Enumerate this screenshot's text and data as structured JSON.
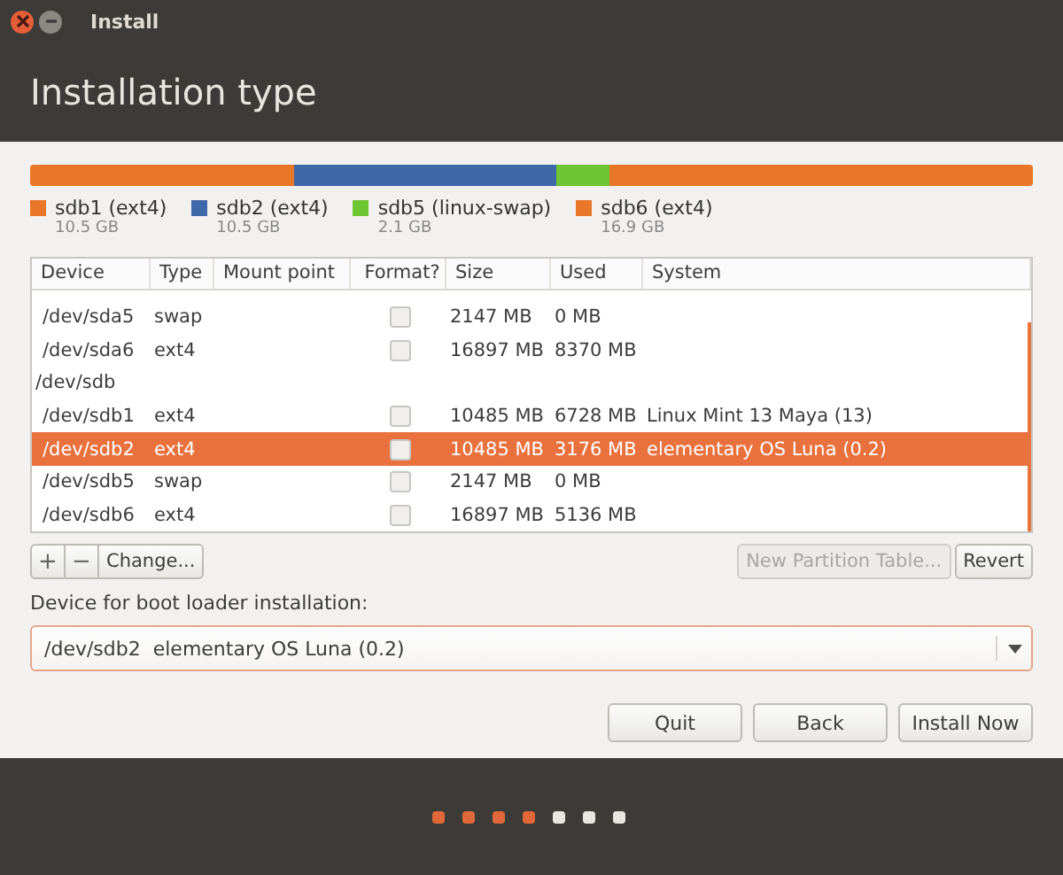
{
  "window": {
    "title": "Install"
  },
  "header": {
    "title": "Installation type"
  },
  "partition_bar": [
    {
      "name": "sdb1 (ext4)",
      "size": "10.5 GB",
      "color": "#e9772a"
    },
    {
      "name": "sdb2 (ext4)",
      "size": "10.5 GB",
      "color": "#3f68a8"
    },
    {
      "name": "sdb5 (linux-swap)",
      "size": "2.1 GB",
      "color": "#6cc531"
    },
    {
      "name": "sdb6 (ext4)",
      "size": "16.9 GB",
      "color": "#e9772a"
    }
  ],
  "table": {
    "columns": [
      "Device",
      "Type",
      "Mount point",
      "Format?",
      "Size",
      "Used",
      "System"
    ],
    "rows": [
      {
        "kind": "partition",
        "device": "/dev/sda5",
        "type": "swap",
        "format": false,
        "size": "2147 MB",
        "used": "0 MB",
        "selected": false
      },
      {
        "kind": "partition",
        "device": "/dev/sda6",
        "type": "ext4",
        "format": false,
        "size": "16897 MB",
        "used": "8370 MB",
        "selected": false
      },
      {
        "kind": "disk",
        "device": "/dev/sdb",
        "selected": false
      },
      {
        "kind": "partition",
        "device": "/dev/sdb1",
        "type": "ext4",
        "format": false,
        "size": "10485 MB",
        "used": "6728 MB",
        "system": "Linux Mint 13 Maya (13)",
        "selected": false
      },
      {
        "kind": "partition",
        "device": "/dev/sdb2",
        "type": "ext4",
        "format": false,
        "size": "10485 MB",
        "used": "3176 MB",
        "system": "elementary OS Luna (0.2)",
        "selected": true
      },
      {
        "kind": "partition",
        "device": "/dev/sdb5",
        "type": "swap",
        "format": false,
        "size": "2147 MB",
        "used": "0 MB",
        "selected": false
      },
      {
        "kind": "partition",
        "device": "/dev/sdb6",
        "type": "ext4",
        "format": false,
        "size": "16897 MB",
        "used": "5136 MB",
        "selected": false
      }
    ]
  },
  "table_buttons": {
    "add": "+",
    "remove": "−",
    "change": "Change..."
  },
  "right_buttons": [
    {
      "label": "New Partition Table...",
      "disabled": true
    },
    {
      "label": "Revert",
      "disabled": false
    }
  ],
  "boot_loader": {
    "label": "Device for boot loader installation:",
    "value": "/dev/sdb2  elementary OS Luna (0.2)"
  },
  "buttons": [
    "Quit",
    "Back",
    "Install Now"
  ],
  "progress_steps": [
    {
      "done": true
    },
    {
      "done": true
    },
    {
      "done": true
    },
    {
      "done": true
    },
    {
      "done": false
    },
    {
      "done": false
    },
    {
      "done": false
    }
  ]
}
